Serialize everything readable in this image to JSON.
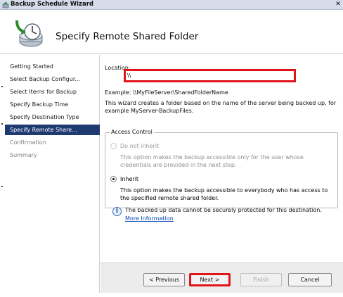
{
  "window": {
    "title": "Backup Schedule Wizard",
    "close_glyph": "✕"
  },
  "header": {
    "heading": "Specify Remote Shared Folder",
    "icon": "backup-wizard-icon"
  },
  "nav": {
    "items": [
      {
        "label": "Getting Started",
        "state": "normal"
      },
      {
        "label": "Select Backup Configur...",
        "state": "normal"
      },
      {
        "label": "Select Items for Backup",
        "state": "normal"
      },
      {
        "label": "Specify Backup Time",
        "state": "normal"
      },
      {
        "label": "Specify Destination Type",
        "state": "normal"
      },
      {
        "label": "Specify Remote Share...",
        "state": "active"
      },
      {
        "label": "Confirmation",
        "state": "disabled"
      },
      {
        "label": "Summary",
        "state": "disabled"
      }
    ]
  },
  "main": {
    "location_label": "Location:",
    "location_value": "\\\\",
    "example": "Example: \\\\MyFileServer\\SharedFolderName",
    "description": "This wizard creates a folder based on the name of the server being backed up, for example MyServer-BackupFiles."
  },
  "access_control": {
    "title": "Access Control",
    "do_not_inherit": {
      "label": "Do not inherit",
      "checked": false,
      "enabled": false,
      "description": "This option makes the backup accessible only for the user whose credentials are provided in the next step."
    },
    "inherit": {
      "label": "Inherit",
      "checked": true,
      "enabled": true,
      "description": "This option makes the backup accessible to everybody who has access to the specified remote shared folder."
    }
  },
  "info": {
    "icon_glyph": "i",
    "text": "The backed up data cannot be securely protected for this destination.",
    "link": "More Information"
  },
  "buttons": {
    "previous": "< Previous",
    "next": "Next >",
    "finish": "Finish",
    "cancel": "Cancel"
  },
  "colors": {
    "highlight": "#e0151b",
    "nav_active": "#1f3971",
    "link": "#0645ad"
  }
}
